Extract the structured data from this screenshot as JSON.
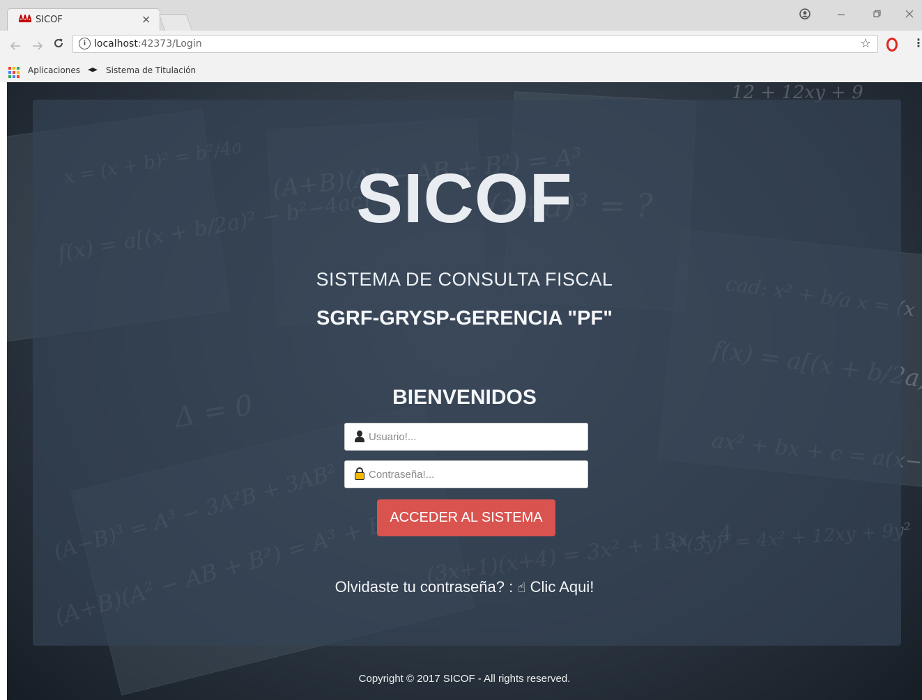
{
  "browser": {
    "tab_title": "SICOF",
    "tab_close": "×",
    "favicon_text": "ꟺ",
    "url_host": "localhost",
    "url_path": ":42373/Login",
    "info_glyph": "i",
    "icons": {
      "back": "arrow-left-icon",
      "forward": "arrow-right-icon",
      "reload": "reload-icon",
      "star": "star-icon",
      "opera": "opera-icon",
      "menu": "kebab-menu-icon",
      "profile": "account-icon"
    },
    "bookmarks": {
      "apps_label": "Aplicaciones",
      "item_label": "Sistema de Titulación"
    }
  },
  "login": {
    "logo": "SICOF",
    "subtitle": "SISTEMA DE CONSULTA FISCAL",
    "org": "SGRF-GRYSP-GERENCIA \"PF\"",
    "welcome": "BIENVENIDOS",
    "username_placeholder": "Usuario!...",
    "password_placeholder": "Contraseña!...",
    "submit_label": "ACCEDER AL SISTEMA",
    "forgot_text": "Olvidaste tu contraseña? :",
    "forgot_link": "Clic Aqui!",
    "footer": "Copyright © 2017 SICOF - All rights reserved.",
    "button_color": "#d9534f"
  }
}
